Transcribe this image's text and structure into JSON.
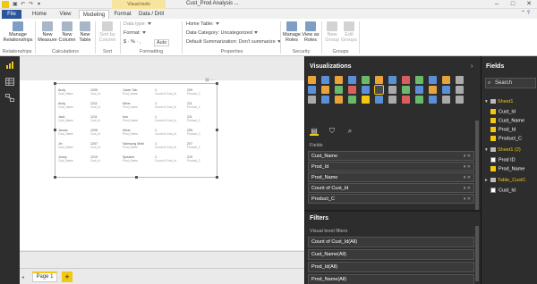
{
  "title_bar": {
    "doc_title": "Cust_Prod Analysis ...",
    "visual_tools_tab": "Visual tools"
  },
  "tabs": [
    "File",
    "Home",
    "View",
    "Modeling",
    "Format",
    "Data / Drill"
  ],
  "ribbon": {
    "relationships": {
      "button": "Manage Relationships",
      "group": "Relationships"
    },
    "calculations": {
      "buttons": [
        "New Measure",
        "New Column",
        "New Table"
      ],
      "group": "Calculations"
    },
    "sort": {
      "button": "Sort by Column",
      "group": "Sort"
    },
    "formatting": {
      "data_type": "Data type:",
      "format": "Format:",
      "symbols": "$ · % · ,",
      "auto": "Auto",
      "group": "Formatting"
    },
    "properties": {
      "home_table": "Home Table:",
      "data_category": "Data Category: Uncategorized",
      "default_summarization": "Default Summarization: Don't summarize",
      "group": "Properties"
    },
    "security": {
      "buttons": [
        "Manage Roles",
        "View as Roles"
      ],
      "group": "Security"
    },
    "groups": {
      "buttons": [
        "New Group",
        "Edit Groups"
      ],
      "group": "Groups"
    }
  },
  "table_visual": {
    "rows": [
      [
        {
          "v": "Andy",
          "l": "Cust_Name"
        },
        {
          "v": "1209",
          "l": "Cust_Id"
        },
        {
          "v": "Juicer Tab",
          "l": "Prod_Name"
        },
        {
          "v": "1",
          "l": "Count of Cust_Id"
        },
        {
          "v": "209",
          "l": "Product_C"
        }
      ],
      [
        {
          "v": "Andy",
          "l": "Cust_Name"
        },
        {
          "v": "1211",
          "l": "Cust_Id"
        },
        {
          "v": "Mixer",
          "l": "Prod_Name"
        },
        {
          "v": "1",
          "l": "Count of Cust_Id"
        },
        {
          "v": "211",
          "l": "Product_C"
        }
      ],
      [
        {
          "v": "Jack",
          "l": "Cust_Name"
        },
        {
          "v": "1211",
          "l": "Cust_Id"
        },
        {
          "v": "iron",
          "l": "Prod_Name"
        },
        {
          "v": "1",
          "l": "Count of Cust_Id"
        },
        {
          "v": "211",
          "l": "Product_C"
        }
      ],
      [
        {
          "v": "James",
          "l": "Cust_Name"
        },
        {
          "v": "1205",
          "l": "Cust_Id"
        },
        {
          "v": "Mixer",
          "l": "Prod_Name"
        },
        {
          "v": "1",
          "l": "Count of Cust_Id"
        },
        {
          "v": "205",
          "l": "Product_C"
        }
      ],
      [
        {
          "v": "Jin",
          "l": "Cust_Name"
        },
        {
          "v": "1207",
          "l": "Cust_Id"
        },
        {
          "v": "Samsung Mobi",
          "l": "Prod_Name"
        },
        {
          "v": "1",
          "l": "Count of Cust_Id"
        },
        {
          "v": "207",
          "l": "Product_C"
        }
      ],
      [
        {
          "v": "Jonny",
          "l": "Cust_Name"
        },
        {
          "v": "1219",
          "l": "Cust_Id"
        },
        {
          "v": "Speaker",
          "l": "Prod_Name"
        },
        {
          "v": "1",
          "l": "Count of Cust_Id"
        },
        {
          "v": "219",
          "l": "Product_C"
        }
      ]
    ]
  },
  "page_tabs": {
    "page1": "Page 1",
    "add": "+"
  },
  "visualizations": {
    "title": "Visualizations",
    "fields_label": "Fields",
    "wells": [
      "Cust_Name",
      "Prod_Id",
      "Prod_Name",
      "Count of Cust_Id",
      "Product_C"
    ],
    "filters_title": "Filters",
    "visual_level_filters": "Visual level filters",
    "filters": [
      "Count of Cust_Id(All)",
      "Cust_Name(All)",
      "Prod_Id(All)",
      "Prod_Name(All)"
    ]
  },
  "fields": {
    "title": "Fields",
    "search_placeholder": "Search",
    "tables": [
      {
        "name": "Sheet1",
        "fields": [
          {
            "n": "Cust_Id",
            "on": true
          },
          {
            "n": "Cust_Name",
            "on": true
          },
          {
            "n": "Prod_Id",
            "on": true
          },
          {
            "n": "Product_C",
            "on": true
          }
        ]
      },
      {
        "name": "Sheet1 (2)",
        "fields": [
          {
            "n": "Prod ID",
            "on": false
          },
          {
            "n": "Prod_Name",
            "on": true
          }
        ]
      },
      {
        "name": "Table_CustC",
        "fields": [
          {
            "n": "Cust_Id",
            "on": false
          }
        ]
      }
    ]
  },
  "colors": {
    "accent": "#f2c811",
    "pane_bg": "#2d2d2d",
    "file_tab": "#2b579a"
  }
}
